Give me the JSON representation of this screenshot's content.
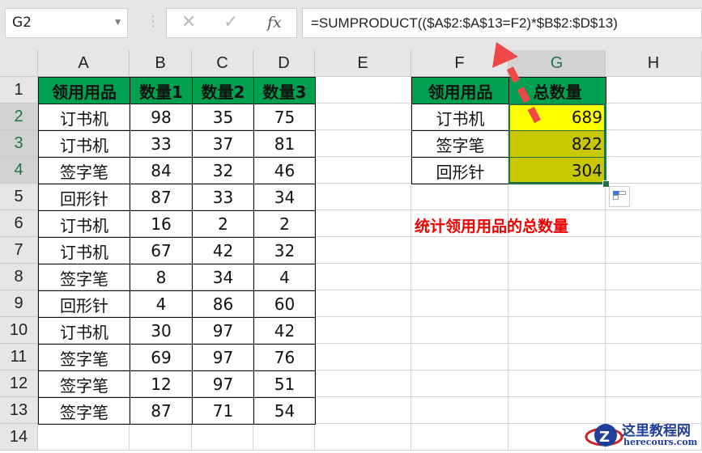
{
  "name_box": "G2",
  "formula_bar": {
    "cancel_icon": "✕",
    "enter_icon": "✓",
    "fx_label": "fx",
    "formula": "=SUMPRODUCT(($A$2:$A$13=F2)*$B$2:$D$13)"
  },
  "columns": [
    "A",
    "B",
    "C",
    "D",
    "E",
    "F",
    "G",
    "H"
  ],
  "rows": [
    "1",
    "2",
    "3",
    "4",
    "5",
    "6",
    "7",
    "8",
    "9",
    "10",
    "11",
    "12",
    "13",
    "14"
  ],
  "table": {
    "headers": [
      "领用用品",
      "数量1",
      "数量2",
      "数量3"
    ],
    "rows": [
      [
        "订书机",
        "98",
        "35",
        "75"
      ],
      [
        "订书机",
        "33",
        "37",
        "81"
      ],
      [
        "签字笔",
        "84",
        "32",
        "46"
      ],
      [
        "回形针",
        "87",
        "33",
        "34"
      ],
      [
        "订书机",
        "16",
        "2",
        "2"
      ],
      [
        "订书机",
        "67",
        "42",
        "32"
      ],
      [
        "签字笔",
        "8",
        "34",
        "4"
      ],
      [
        "回形针",
        "4",
        "86",
        "60"
      ],
      [
        "订书机",
        "30",
        "97",
        "42"
      ],
      [
        "签字笔",
        "69",
        "97",
        "76"
      ],
      [
        "签字笔",
        "12",
        "97",
        "51"
      ],
      [
        "签字笔",
        "87",
        "71",
        "54"
      ]
    ]
  },
  "summary": {
    "headers": [
      "领用用品",
      "总数量"
    ],
    "rows": [
      [
        "订书机",
        "689"
      ],
      [
        "签字笔",
        "822"
      ],
      [
        "回形针",
        "304"
      ]
    ]
  },
  "note": "统计领用用品的总数量",
  "watermark": {
    "title": "这里教程网",
    "url": "herecours.com"
  },
  "colors": {
    "header_green": "#00a050",
    "active_yellow": "#ffff00",
    "filled_olive": "#c8c800",
    "note_red": "#ee0000"
  }
}
